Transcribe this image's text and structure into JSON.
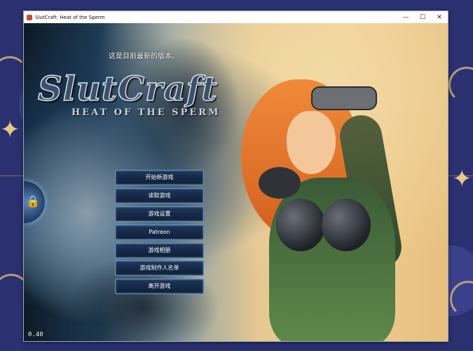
{
  "window": {
    "title": "SlutCraft: Heat of the Sperm",
    "minimize": "—",
    "maximize": "☐",
    "close": "✕"
  },
  "game": {
    "notice": "这是目前最新的版本。",
    "logo_title": "SlutCraft",
    "logo_subtitle": "HEAT OF THE SPERM",
    "lock_icon": "🔒",
    "menu": [
      "开始新游戏",
      "读取游戏",
      "游戏设置",
      "Patreon",
      "游戏相册",
      "游戏制作人名单",
      "离开游戏"
    ],
    "version": "0.40"
  }
}
